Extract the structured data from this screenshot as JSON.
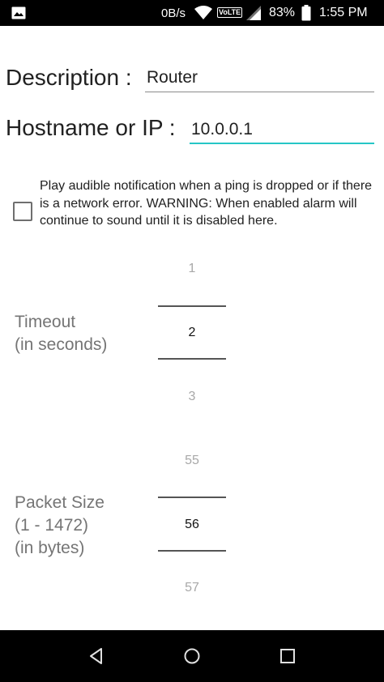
{
  "status_bar": {
    "network_speed": "0B/s",
    "volte": "VoLTE",
    "battery": "83%",
    "time": "1:55 PM",
    "icons": [
      "gallery-icon",
      "wifi-icon",
      "signal-icon",
      "battery-icon"
    ]
  },
  "form": {
    "description": {
      "label": "Description :",
      "value": "Router"
    },
    "hostname": {
      "label": "Hostname or IP :",
      "value": "10.0.0.1"
    },
    "alarm": {
      "checked": false,
      "text": "Play audible notification when a ping is dropped or if there is a network error. WARNING: When enabled alarm will continue to sound until it is disabled here."
    },
    "timeout": {
      "label_line1": "Timeout",
      "label_line2": "(in seconds)",
      "prev": "1",
      "current": "2",
      "next": "3"
    },
    "packet_size": {
      "label_line1": "Packet Size",
      "label_line2": "(1 - 1472)",
      "label_line3": "(in bytes)",
      "prev": "55",
      "current": "56",
      "next": "57"
    }
  },
  "colors": {
    "accent": "#26c6c6",
    "status_bar": "#000000",
    "nav_bar": "#000000"
  },
  "nav_bar": {
    "icons": [
      "back-icon",
      "home-icon",
      "recents-icon"
    ]
  }
}
